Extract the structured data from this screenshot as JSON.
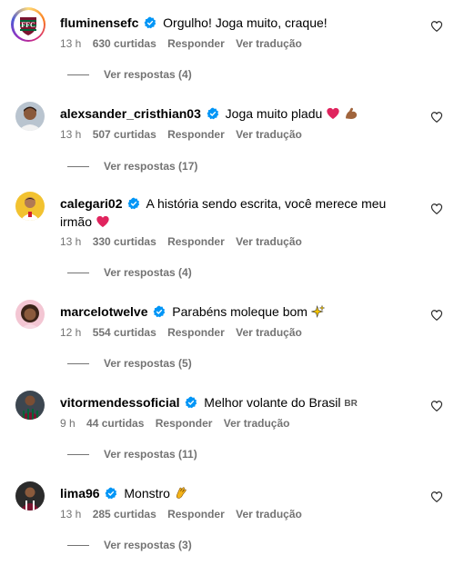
{
  "comments": [
    {
      "username": "fluminensefc",
      "text": "Orgulho! Joga muito, craque!",
      "time": "13 h",
      "likes": "630 curtidas",
      "reply": "Responder",
      "translate": "Ver tradução",
      "replies": "Ver respostas (4)"
    },
    {
      "username": "alexsander_cristhian03",
      "text": "Joga muito pladu",
      "emojis": [
        "red-heart",
        "flexed-biceps"
      ],
      "time": "13 h",
      "likes": "507 curtidas",
      "reply": "Responder",
      "translate": "Ver tradução",
      "replies": "Ver respostas (17)"
    },
    {
      "username": "calegari02",
      "text": "A história sendo escrita, você merece meu irmão",
      "emojis": [
        "red-heart"
      ],
      "time": "13 h",
      "likes": "330 curtidas",
      "reply": "Responder",
      "translate": "Ver tradução",
      "replies": "Ver respostas (4)"
    },
    {
      "username": "marcelotwelve",
      "text": "Parabéns moleque bom",
      "emojis": [
        "sparkles"
      ],
      "time": "12 h",
      "likes": "554 curtidas",
      "reply": "Responder",
      "translate": "Ver tradução",
      "replies": "Ver respostas (5)"
    },
    {
      "username": "vitormendessoficial",
      "text": "Melhor volante do Brasil",
      "flag": "BR",
      "time": "9 h",
      "likes": "44 curtidas",
      "reply": "Responder",
      "translate": "Ver tradução",
      "replies": "Ver respostas (11)"
    },
    {
      "username": "lima96",
      "text": "Monstro",
      "emojis": [
        "clapping-hands"
      ],
      "time": "13 h",
      "likes": "285 curtidas",
      "reply": "Responder",
      "translate": "Ver tradução",
      "replies": "Ver respostas (3)"
    }
  ],
  "colors": {
    "verified": "#0095f6",
    "secondary_text": "#737373",
    "heart_emoji": "#e0245e"
  }
}
